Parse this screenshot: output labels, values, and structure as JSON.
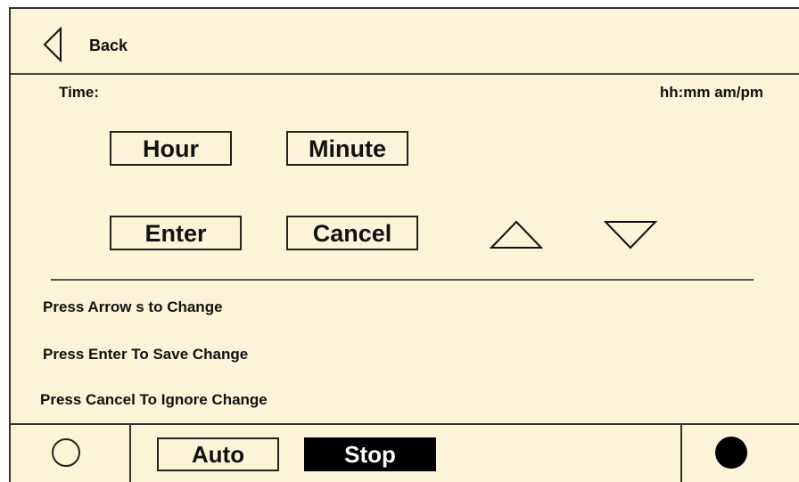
{
  "header": {
    "back_label": "Back",
    "back_icon": "left-triangle-outline"
  },
  "time": {
    "label": "Time:",
    "format": "hh:mm am/pm"
  },
  "buttons": {
    "hour": "Hour",
    "minute": "Minute",
    "enter": "Enter",
    "cancel": "Cancel"
  },
  "arrows": {
    "up_icon": "triangle-up-outline",
    "down_icon": "triangle-down-outline"
  },
  "instructions": [
    "Press Arrow s to Change",
    "Press Enter To Save Change",
    "Press Cancel To Ignore Change"
  ],
  "footer": {
    "left_icon": "open-circle",
    "auto_label": "Auto",
    "stop_label": "Stop",
    "right_icon": "filled-circle"
  },
  "colors": {
    "panel_background": "#fbf4d9",
    "stop_background": "#000000",
    "stop_text": "#ffffff"
  }
}
